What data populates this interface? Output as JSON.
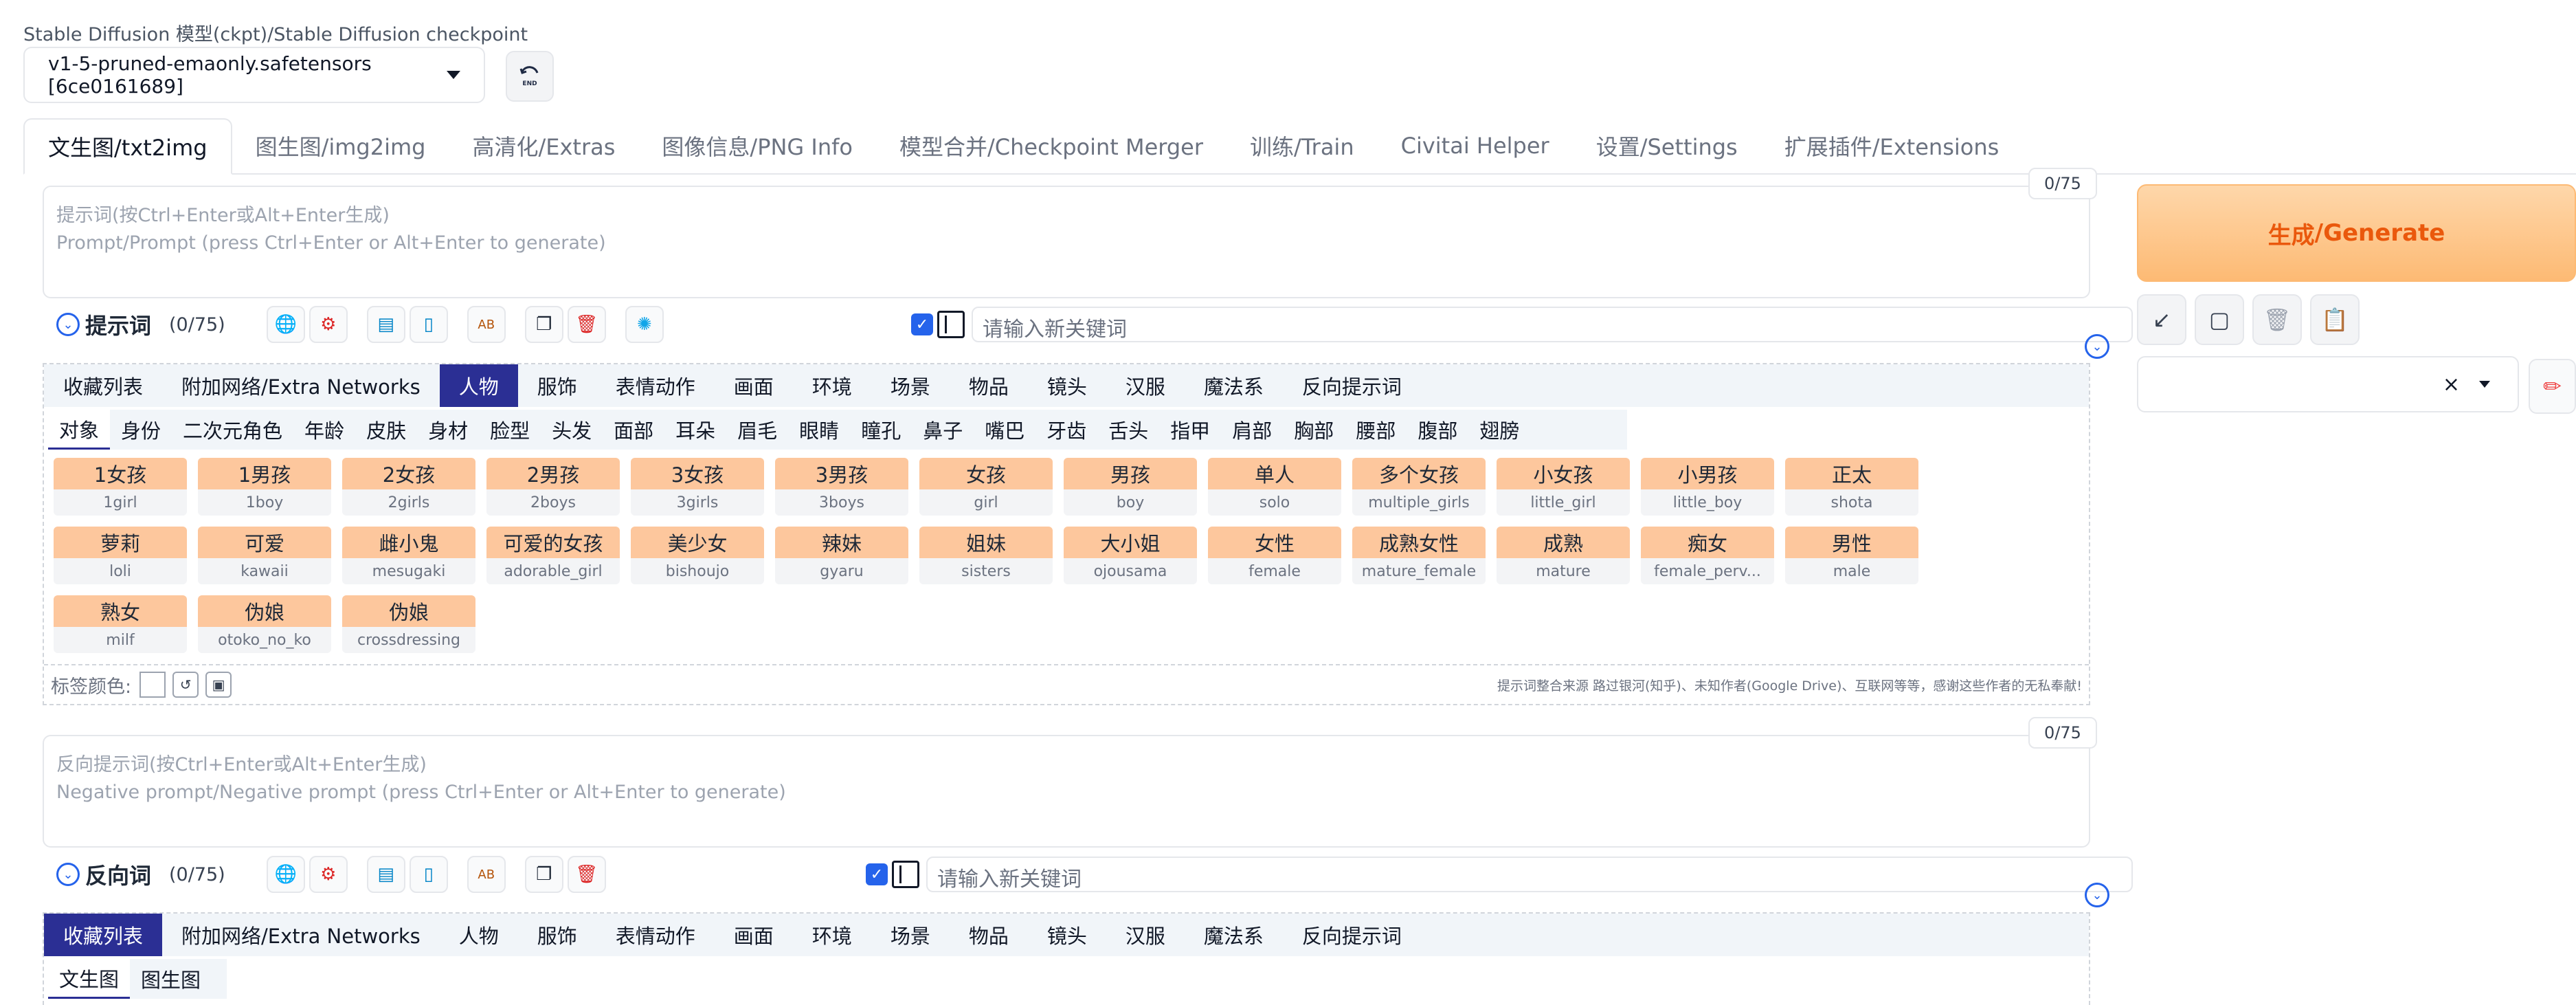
{
  "checkpoint": {
    "label": "Stable Diffusion 模型(ckpt)/Stable Diffusion checkpoint",
    "selected": "v1-5-pruned-emaonly.safetensors [6ce0161689]",
    "refresh_icon": "refresh-end-icon"
  },
  "tabs": [
    {
      "label": "文生图/txt2img",
      "active": true
    },
    {
      "label": "图生图/img2img"
    },
    {
      "label": "高清化/Extras"
    },
    {
      "label": "图像信息/PNG Info"
    },
    {
      "label": "模型合并/Checkpoint Merger"
    },
    {
      "label": "训练/Train"
    },
    {
      "label": "Civitai Helper"
    },
    {
      "label": "设置/Settings"
    },
    {
      "label": "扩展插件/Extensions"
    }
  ],
  "prompt": {
    "placeholder_zh": "提示词(按Ctrl+Enter或Alt+Enter生成)",
    "placeholder_en": "Prompt/Prompt (press Ctrl+Enter or Alt+Enter to generate)",
    "counter": "0/75",
    "title": "提示词",
    "count": "(0/75)",
    "keyword_placeholder": "请输入新关键词"
  },
  "negative": {
    "placeholder_zh": "反向提示词(按Ctrl+Enter或Alt+Enter生成)",
    "placeholder_en": "Negative prompt/Negative prompt (press Ctrl+Enter or Alt+Enter to generate)",
    "counter": "0/75",
    "title": "反向词",
    "count": "(0/75)",
    "keyword_placeholder": "请输入新关键词"
  },
  "categories": [
    "收藏列表",
    "附加网络/Extra Networks",
    "人物",
    "服饰",
    "表情动作",
    "画面",
    "环境",
    "场景",
    "物品",
    "镜头",
    "汉服",
    "魔法系",
    "反向提示词"
  ],
  "subcategories": [
    "对象",
    "身份",
    "二次元角色",
    "年龄",
    "皮肤",
    "身材",
    "脸型",
    "头发",
    "面部",
    "耳朵",
    "眉毛",
    "眼睛",
    "瞳孔",
    "鼻子",
    "嘴巴",
    "牙齿",
    "舌头",
    "指甲",
    "肩部",
    "胸部",
    "腰部",
    "腹部",
    "翅膀"
  ],
  "tags": [
    {
      "zh": "1女孩",
      "en": "1girl"
    },
    {
      "zh": "1男孩",
      "en": "1boy"
    },
    {
      "zh": "2女孩",
      "en": "2girls"
    },
    {
      "zh": "2男孩",
      "en": "2boys"
    },
    {
      "zh": "3女孩",
      "en": "3girls"
    },
    {
      "zh": "3男孩",
      "en": "3boys"
    },
    {
      "zh": "女孩",
      "en": "girl"
    },
    {
      "zh": "男孩",
      "en": "boy"
    },
    {
      "zh": "单人",
      "en": "solo"
    },
    {
      "zh": "多个女孩",
      "en": "multiple_girls"
    },
    {
      "zh": "小女孩",
      "en": "little_girl"
    },
    {
      "zh": "小男孩",
      "en": "little_boy"
    },
    {
      "zh": "正太",
      "en": "shota"
    },
    {
      "zh": "萝莉",
      "en": "loli"
    },
    {
      "zh": "可爱",
      "en": "kawaii"
    },
    {
      "zh": "雌小鬼",
      "en": "mesugaki"
    },
    {
      "zh": "可爱的女孩",
      "en": "adorable_girl"
    },
    {
      "zh": "美少女",
      "en": "bishoujo"
    },
    {
      "zh": "辣妹",
      "en": "gyaru"
    },
    {
      "zh": "姐妹",
      "en": "sisters"
    },
    {
      "zh": "大小姐",
      "en": "ojousama"
    },
    {
      "zh": "女性",
      "en": "female"
    },
    {
      "zh": "成熟女性",
      "en": "mature_female"
    },
    {
      "zh": "成熟",
      "en": "mature"
    },
    {
      "zh": "痴女",
      "en": "female_perv..."
    },
    {
      "zh": "男性",
      "en": "male"
    },
    {
      "zh": "熟女",
      "en": "milf"
    },
    {
      "zh": "伪娘",
      "en": "otoko_no_ko"
    },
    {
      "zh": "伪娘",
      "en": "crossdressing"
    }
  ],
  "footer": {
    "label": "标签颜色:",
    "credit": "提示词整合来源 路过银河(知乎)、未知作者(Google Drive)、互联网等等，感谢这些作者的无私奉献!"
  },
  "negative_subtabs": [
    "文生图",
    "图生图"
  ],
  "generate": {
    "zh": "生成",
    "en": "/Generate"
  },
  "style_select": {
    "clear": "×"
  },
  "colors": {
    "active_tab_bg": "#2b2f94",
    "tag_bg": "#fdc79d",
    "generate_text": "#ea580c",
    "accent_blue": "#2563eb"
  }
}
